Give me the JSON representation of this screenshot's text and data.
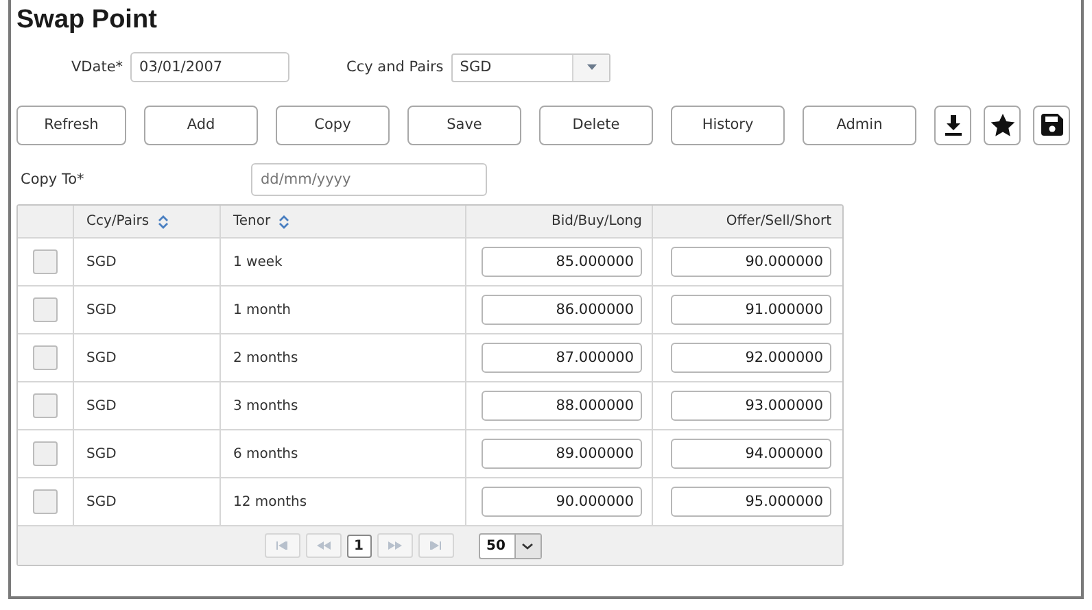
{
  "title": "Swap Point",
  "vdate": {
    "label": "VDate*",
    "value": "03/01/2007"
  },
  "ccy": {
    "label": "Ccy and Pairs",
    "value": "SGD"
  },
  "buttons": [
    "Refresh",
    "Add",
    "Copy",
    "Save",
    "Delete",
    "History",
    "Admin"
  ],
  "icon_buttons": [
    {
      "kind": "download"
    },
    {
      "kind": "star"
    },
    {
      "kind": "save"
    }
  ],
  "copy_to": {
    "label": "Copy To*",
    "placeholder": "dd/mm/yyyy"
  },
  "table": {
    "columns": [
      "Ccy/Pairs",
      "Tenor",
      "Bid/Buy/Long",
      "Offer/Sell/Short"
    ],
    "rows": [
      {
        "checked": false,
        "ccy": "SGD",
        "tenor": "1 week",
        "bid": "85.000000",
        "offer": "90.000000"
      },
      {
        "checked": false,
        "ccy": "SGD",
        "tenor": "1 month",
        "bid": "86.000000",
        "offer": "91.000000"
      },
      {
        "checked": false,
        "ccy": "SGD",
        "tenor": "2 months",
        "bid": "87.000000",
        "offer": "92.000000"
      },
      {
        "checked": false,
        "ccy": "SGD",
        "tenor": "3 months",
        "bid": "88.000000",
        "offer": "93.000000"
      },
      {
        "checked": false,
        "ccy": "SGD",
        "tenor": "6 months",
        "bid": "89.000000",
        "offer": "94.000000"
      },
      {
        "checked": false,
        "ccy": "SGD",
        "tenor": "12 months",
        "bid": "90.000000",
        "offer": "95.000000"
      }
    ]
  },
  "pager": {
    "page": "1",
    "page_size": "50"
  }
}
